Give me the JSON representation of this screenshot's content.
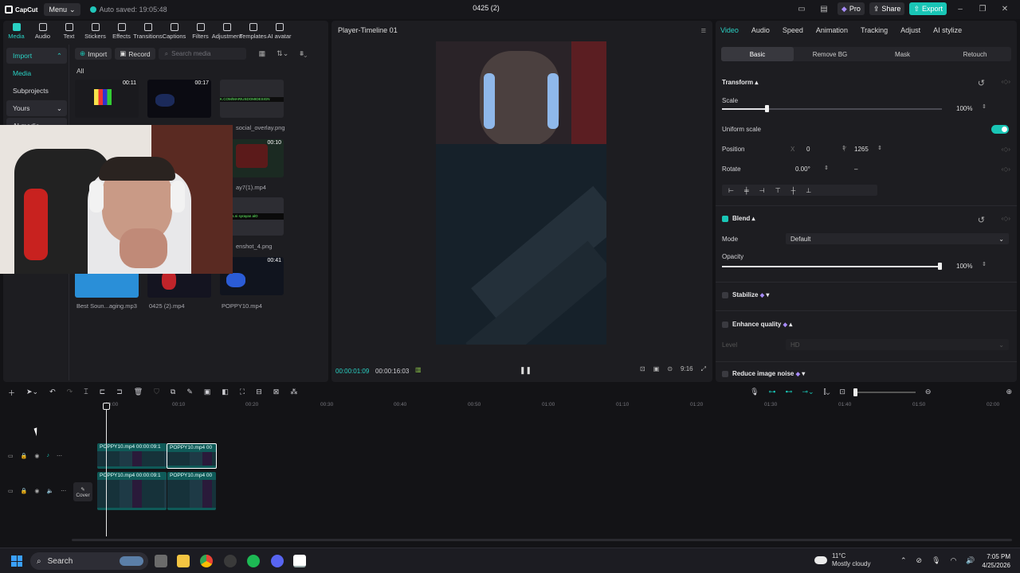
{
  "app": {
    "logo": "CapCut",
    "menu_label": "Menu",
    "autosave": "Auto saved: 19:05:48",
    "project_title": "0425 (2)",
    "pro_label": "Pro",
    "share_label": "Share",
    "export_label": "Export"
  },
  "toolbar": [
    {
      "label": "Media"
    },
    {
      "label": "Audio"
    },
    {
      "label": "Text"
    },
    {
      "label": "Stickers"
    },
    {
      "label": "Effects"
    },
    {
      "label": "Transitions"
    },
    {
      "label": "Captions"
    },
    {
      "label": "Filters"
    },
    {
      "label": "Adjustment"
    },
    {
      "label": "Templates"
    },
    {
      "label": "AI avatar"
    }
  ],
  "sidebar": {
    "import": "Import",
    "media": "Media",
    "subprojects": "Subprojects",
    "yours": "Yours",
    "ai_media": "AI media"
  },
  "media": {
    "import_btn": "Import",
    "record_btn": "Record",
    "search_placeholder": "Search media",
    "all_tab": "All",
    "items": [
      {
        "name": "",
        "duration": "00:11"
      },
      {
        "name": "",
        "duration": "00:17"
      },
      {
        "name": "social_overlay.png",
        "duration": ""
      },
      {
        "name": "ay7(1).mp4",
        "duration": "00:10"
      },
      {
        "name": "enshot_4.png",
        "duration": ""
      },
      {
        "name": "Best Soun...aging.mp3",
        "duration": ""
      },
      {
        "name": "0425 (2).mp4",
        "duration": ""
      },
      {
        "name": "POPPY10.mp4",
        "duration": "00:41"
      }
    ],
    "overlay_strip_text": "K.COM/MARIUSDOMIDESIGN",
    "overlay_strip_text2": "Bobbin s.ni syrayan alO",
    "item_tag": "ed"
  },
  "player": {
    "title": "Player-Timeline 01",
    "current_time": "00:00:01:09",
    "total_time": "00:00:16:03",
    "aspect": "9:16"
  },
  "props": {
    "tabs": [
      "Video",
      "Audio",
      "Speed",
      "Animation",
      "Tracking",
      "Adjust",
      "AI stylize"
    ],
    "subtabs": [
      "Basic",
      "Remove BG",
      "Mask",
      "Retouch"
    ],
    "transform": "Transform",
    "scale_label": "Scale",
    "scale_value": "100%",
    "uniform_scale": "Uniform scale",
    "position_label": "Position",
    "pos_x_label": "X",
    "pos_x": "0",
    "pos_y_label": "Y",
    "pos_y": "1265",
    "rotate_label": "Rotate",
    "rotate_value": "0.00°",
    "rotate_dash": "–",
    "blend": "Blend",
    "mode_label": "Mode",
    "mode_value": "Default",
    "opacity_label": "Opacity",
    "opacity_value": "100%",
    "stabilize": "Stabilize",
    "enhance_quality": "Enhance quality",
    "level_label": "Level",
    "level_value": "HD",
    "reduce_noise": "Reduce image noise",
    "accent_color": "#19c6b6"
  },
  "timeline": {
    "ruler": [
      "00:00",
      "00:10",
      "00:20",
      "00:30",
      "00:40",
      "00:50",
      "01:00",
      "01:10",
      "01:20",
      "01:30",
      "01:40",
      "01:50",
      "02:00"
    ],
    "clips_top": [
      {
        "label": "POPPY10.mp4  00:00:09:1"
      },
      {
        "label": "POPPY10.mp4  00"
      }
    ],
    "clips_bottom": [
      {
        "label": "POPPY10.mp4  00:00:09:1"
      },
      {
        "label": "POPPY10.mp4  00"
      }
    ],
    "cover_label": "Cover"
  },
  "taskbar": {
    "search": "Search",
    "temp": "11°C",
    "weather": "Mostly cloudy",
    "time": "7:05 PM",
    "date": "4/25/2026"
  }
}
